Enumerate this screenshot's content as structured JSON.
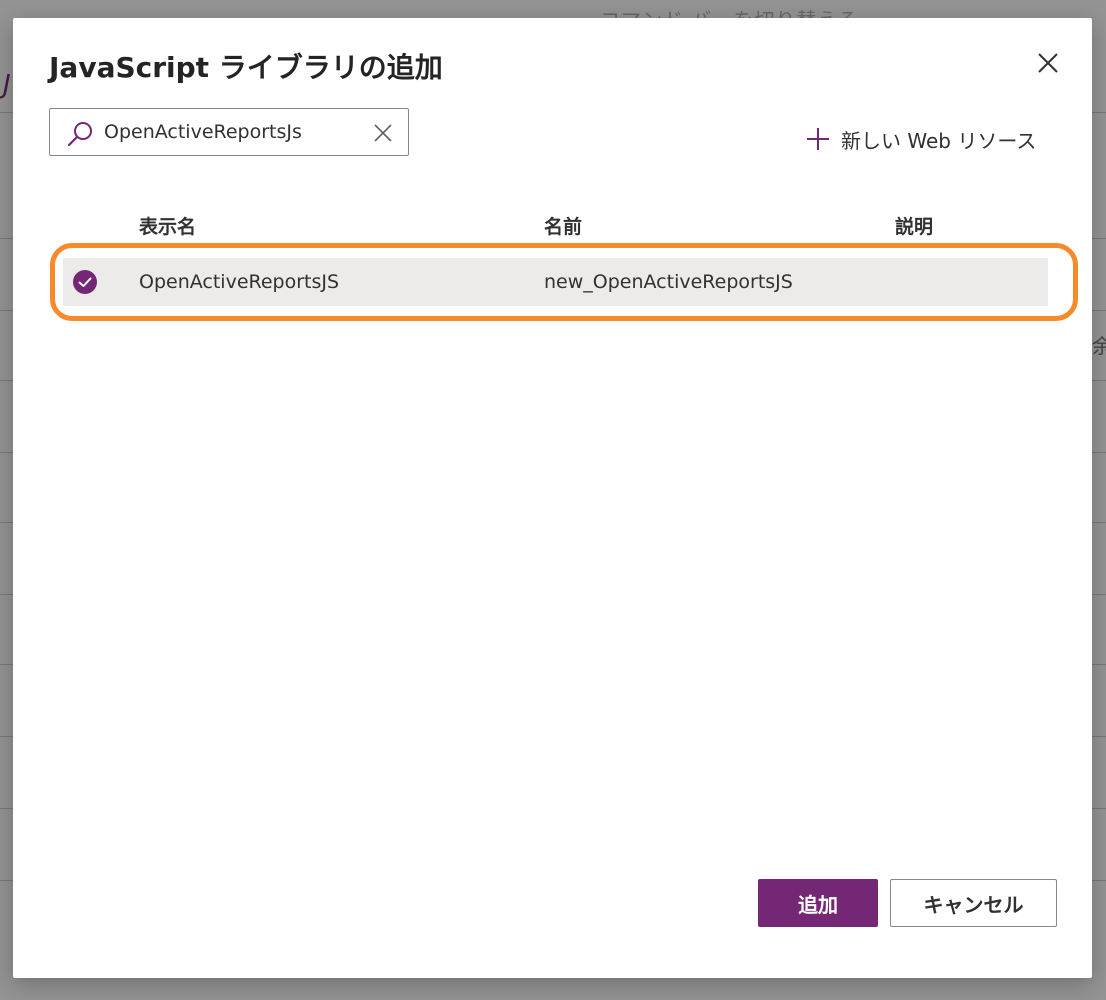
{
  "background": {
    "topbar_text": "コマンド バーを切り替える",
    "left_letter": "J",
    "right_glyph": "余"
  },
  "dialog": {
    "title": "JavaScript ライブラリの追加",
    "close_icon": "close-icon"
  },
  "search": {
    "value": "OpenActiveReportsJs",
    "placeholder": "",
    "icon": "search-icon",
    "clear_icon": "clear-icon"
  },
  "new_resource": {
    "label": "新しい Web リソース",
    "icon": "plus-icon"
  },
  "table": {
    "columns": [
      "表示名",
      "名前",
      "説明"
    ],
    "rows": [
      {
        "selected": true,
        "display_name": "OpenActiveReportsJS",
        "name": "new_OpenActiveReportsJS",
        "description": ""
      }
    ]
  },
  "buttons": {
    "add": "追加",
    "cancel": "キャンセル"
  },
  "colors": {
    "accent": "#742774",
    "highlight": "#f78a2a",
    "row_selected": "#edebe9"
  }
}
